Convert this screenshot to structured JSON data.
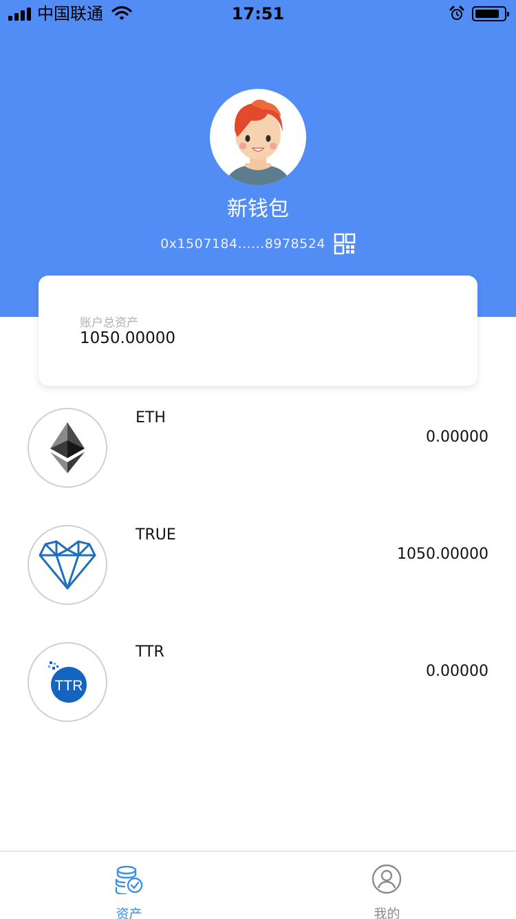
{
  "status_bar": {
    "carrier": "中国联通",
    "time": "17:51",
    "battery_level": 0.85
  },
  "profile": {
    "wallet_name": "新钱包",
    "address": "0x1507184......8978524"
  },
  "summary": {
    "label": "账户总资产",
    "value": "1050.00000"
  },
  "tokens": [
    {
      "symbol": "ETH",
      "amount": "0.00000",
      "icon": "ethereum-icon"
    },
    {
      "symbol": "TRUE",
      "amount": "1050.00000",
      "icon": "diamond-heart-icon"
    },
    {
      "symbol": "TTR",
      "amount": "0.00000",
      "icon": "ttr-icon",
      "icon_text": "TTR"
    }
  ],
  "tabs": [
    {
      "label": "资产",
      "icon": "coins-icon",
      "active": true
    },
    {
      "label": "我的",
      "icon": "user-icon",
      "active": false
    }
  ],
  "colors": {
    "header": "#528cf5",
    "active_tab": "#3b8ee0",
    "inactive_tab": "#8a8a8a"
  }
}
